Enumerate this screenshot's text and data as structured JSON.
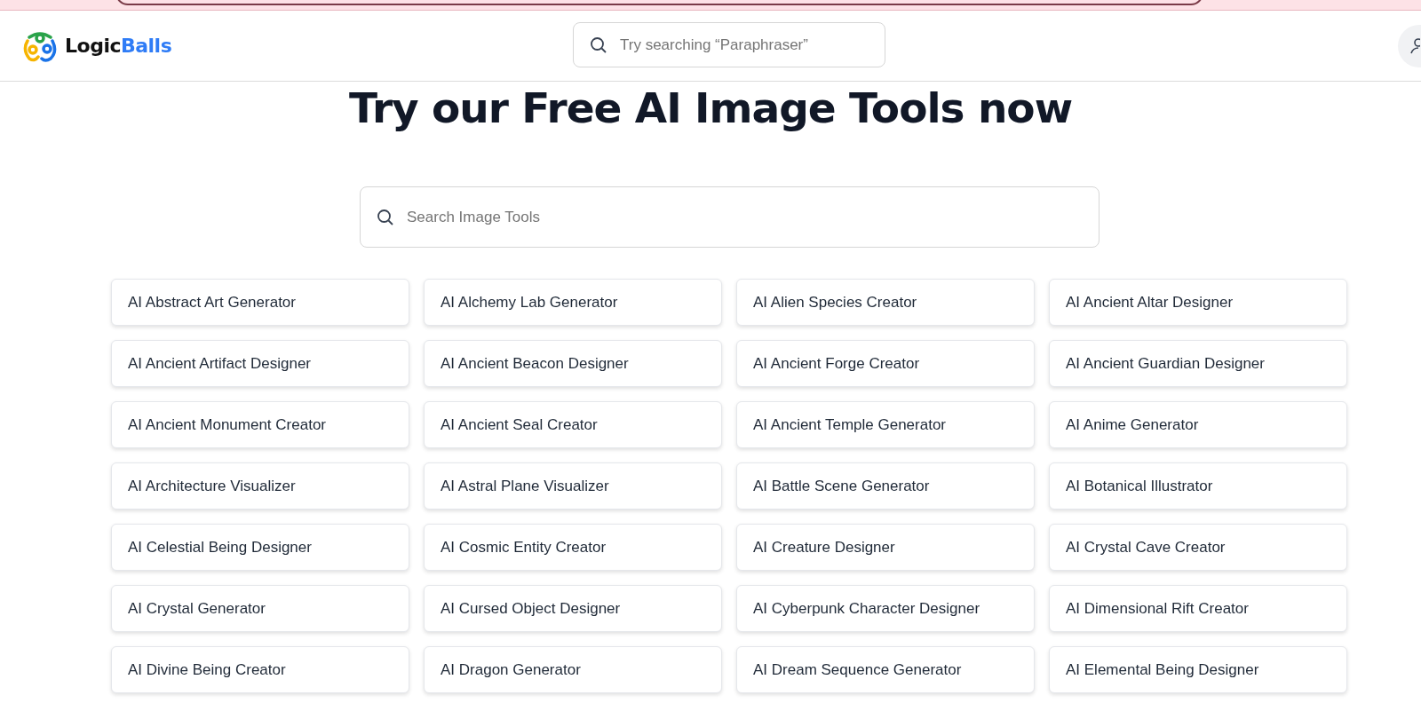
{
  "header": {
    "logo": {
      "part_1": "Logic",
      "part_2": "Balls"
    },
    "search": {
      "placeholder": "Try searching “Paraphraser”"
    }
  },
  "heading": "Try our Free AI Image Tools now",
  "tool_search": {
    "placeholder": "Search Image Tools"
  },
  "tools": [
    "AI Abstract Art Generator",
    "AI Alchemy Lab Generator",
    "AI Alien Species Creator",
    "AI Ancient Altar Designer",
    "AI Ancient Artifact Designer",
    "AI Ancient Beacon Designer",
    "AI Ancient Forge Creator",
    "AI Ancient Guardian Designer",
    "AI Ancient Monument Creator",
    "AI Ancient Seal Creator",
    "AI Ancient Temple Generator",
    "AI Anime Generator",
    "AI Architecture Visualizer",
    "AI Astral Plane Visualizer",
    "AI Battle Scene Generator",
    "AI Botanical Illustrator",
    "AI Celestial Being Designer",
    "AI Cosmic Entity Creator",
    "AI Creature Designer",
    "AI Crystal Cave Creator",
    "AI Crystal Generator",
    "AI Cursed Object Designer",
    "AI Cyberpunk Character Designer",
    "AI Dimensional Rift Creator",
    "AI Divine Being Creator",
    "AI Dragon Generator",
    "AI Dream Sequence Generator",
    "AI Elemental Being Designer"
  ]
}
